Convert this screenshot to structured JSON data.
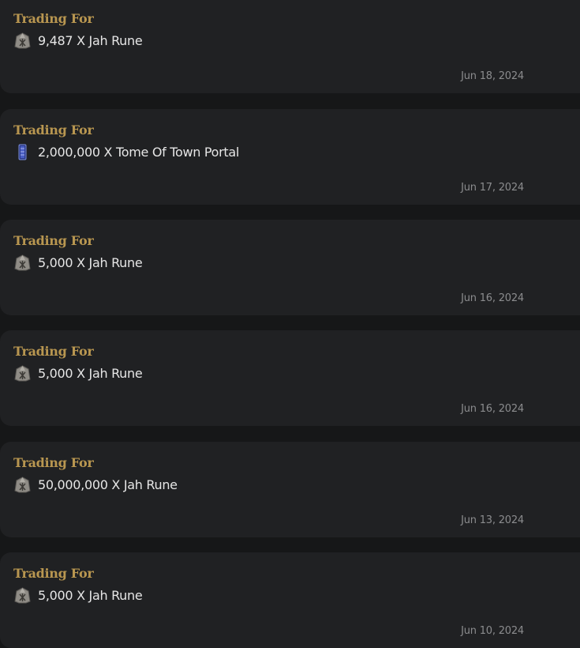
{
  "trades": [
    {
      "heading": "Trading For",
      "item_text": "9,487 X Jah Rune",
      "icon": "jah-rune-icon",
      "date": "Jun 18, 2024"
    },
    {
      "heading": "Trading For",
      "item_text": "2,000,000 X Tome Of Town Portal",
      "icon": "tome-of-town-portal-icon",
      "date": "Jun 17, 2024"
    },
    {
      "heading": "Trading For",
      "item_text": "5,000 X Jah Rune",
      "icon": "jah-rune-icon",
      "date": "Jun 16, 2024"
    },
    {
      "heading": "Trading For",
      "item_text": "5,000 X Jah Rune",
      "icon": "jah-rune-icon",
      "date": "Jun 16, 2024"
    },
    {
      "heading": "Trading For",
      "item_text": "50,000,000 X Jah Rune",
      "icon": "jah-rune-icon",
      "date": "Jun 13, 2024"
    },
    {
      "heading": "Trading For",
      "item_text": "5,000 X Jah Rune",
      "icon": "jah-rune-icon",
      "date": "Jun 10, 2024"
    }
  ],
  "colors": {
    "page_background": "#161718",
    "card_background": "#202123",
    "heading": "#b89650",
    "item_text": "#e6e6e6",
    "date": "#8b8c8e"
  }
}
